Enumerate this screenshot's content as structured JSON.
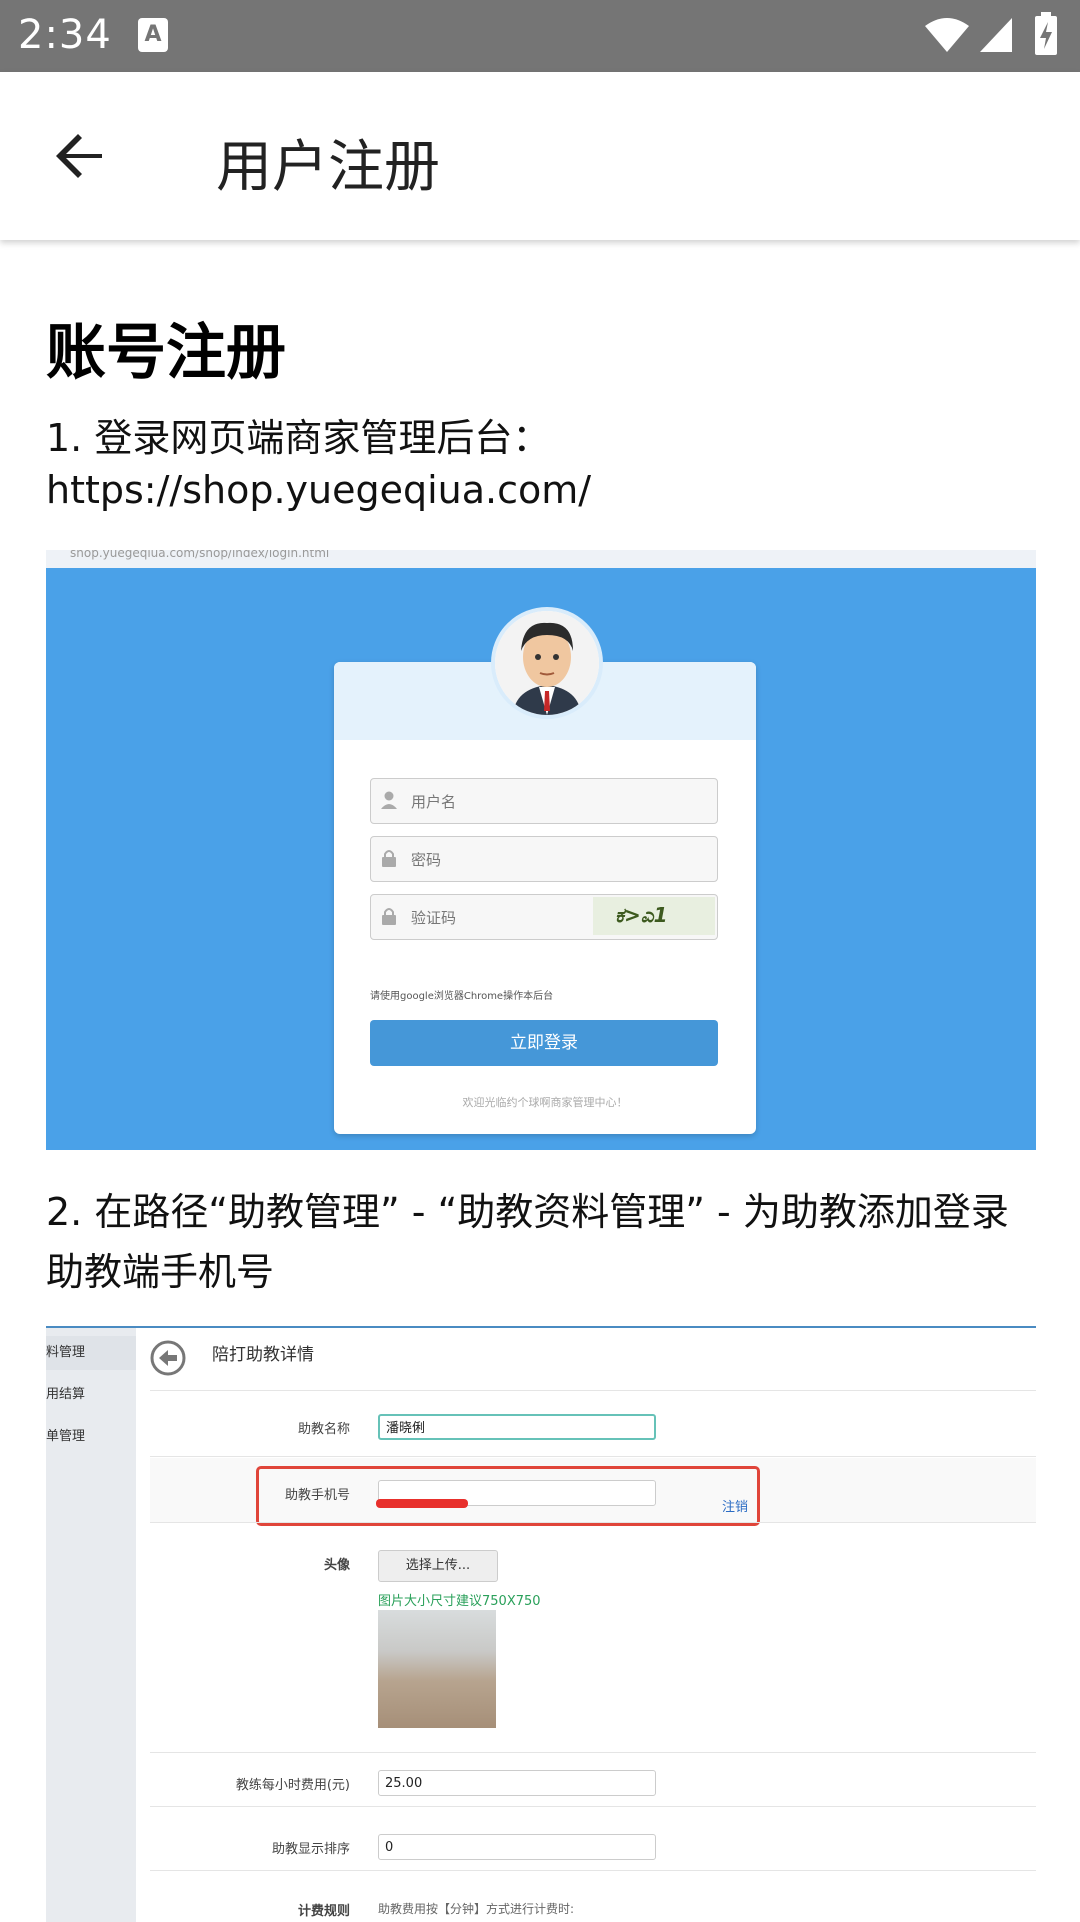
{
  "status_bar": {
    "time": "2:34",
    "notif_icon_letter": "A"
  },
  "app_bar": {
    "title": "用户注册"
  },
  "content": {
    "heading": "账号注册",
    "step1": "1. 登录网页端商家管理后台：https://shop.yuegeqiua.com/",
    "step2": "2. 在路径“助教管理” - “助教资料管理” - 为助教添加登录助教端手机号"
  },
  "login_shot": {
    "url": "shop.yuegeqiua.com/shop/index/login.html",
    "username_placeholder": "用户名",
    "password_placeholder": "密码",
    "captcha_placeholder": "验证码",
    "captcha_text": "ಕ>ಎ1",
    "hint": "请使用google浏览器Chrome操作本后台",
    "login_button": "立即登录",
    "welcome": "欢迎光临约个球啊商家管理中心！"
  },
  "admin_shot": {
    "sidebar": [
      "料管理",
      "用结算",
      "单管理"
    ],
    "page_heading": "陪打助教详情",
    "fields": {
      "name_label": "助教名称",
      "name_value": "潘晓俐",
      "phone_label": "助教手机号",
      "phone_cancel": "注销",
      "avatar_label": "头像",
      "upload_button": "选择上传...",
      "size_note": "图片大小尺寸建议750X750",
      "fee_label": "教练每小时费用(元)",
      "fee_value": "25.00",
      "order_label": "助教显示排序",
      "order_value": "0",
      "rule_label": "计费规则",
      "rule_value": "助教费用按【分钟】方式进行计费时:"
    }
  }
}
